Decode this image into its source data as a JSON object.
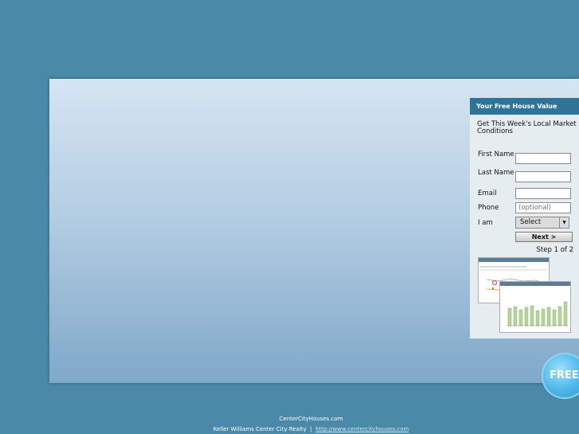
{
  "panel": {
    "title": "Your Free House Value",
    "subtitle": "Get This Week's Local Market Conditions",
    "fields": {
      "first_name_label": "First Name",
      "last_name_label": "Last Name",
      "email_label": "Email",
      "phone_label": "Phone",
      "phone_placeholder": "(optional)",
      "iam_label": "I am",
      "iam_value": "Select"
    },
    "next_label": "Next >",
    "step_text": "Step 1 of 2"
  },
  "badge": {
    "text": "FREE",
    "color": "#4cb8ea"
  },
  "footer": {
    "site": "CenterCityHouses.com",
    "company": "Keller Williams Center City Realty",
    "separator": "|",
    "link": "http://www.centercityhouses.com"
  },
  "colors": {
    "background": "#4a89a8",
    "header": "#2e7498"
  }
}
